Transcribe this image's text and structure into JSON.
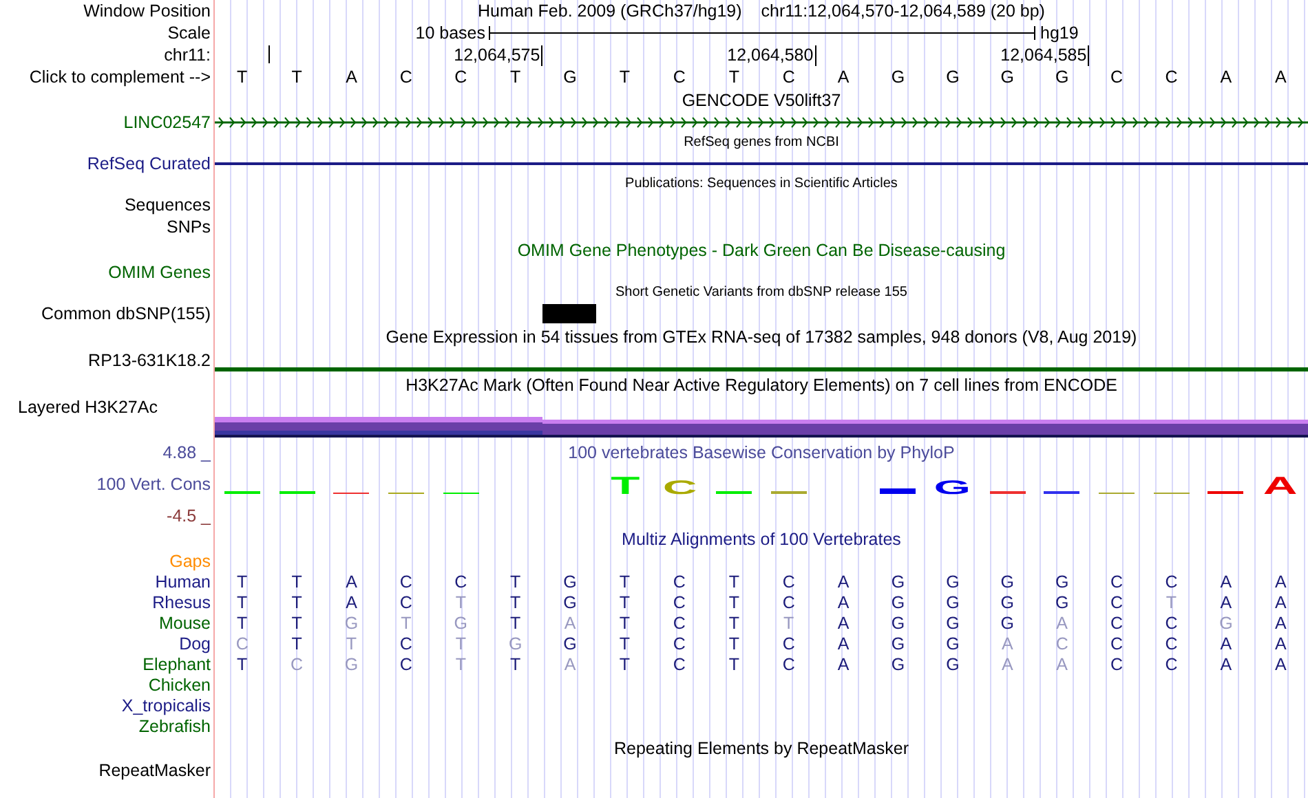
{
  "rows": [
    {
      "kind": "position",
      "label": {
        "text": "Window Position",
        "color": "#000000"
      },
      "assembly": "Human Feb. 2009 (GRCh37/hg19)",
      "position": "chr11:12,064,570-12,064,589 (20 bp)"
    },
    {
      "kind": "scale",
      "label": {
        "text": "Scale",
        "color": "#000000"
      },
      "span": "10 bases",
      "db": "hg19"
    },
    {
      "kind": "ruler",
      "label": {
        "text": "chr11:",
        "color": "#000000"
      },
      "ticks": [
        "12,064,575",
        "12,064,580",
        "12,064,585"
      ]
    },
    {
      "kind": "bases",
      "label": {
        "text": "Click to complement -->",
        "color": "#000000"
      },
      "letters": [
        "T",
        "T",
        "A",
        "C",
        "C",
        "T",
        "G",
        "T",
        "C",
        "T",
        "C",
        "A",
        "G",
        "G",
        "G",
        "G",
        "C",
        "C",
        "A",
        "A"
      ]
    },
    {
      "kind": "title",
      "text": "GENCODE V50lift37",
      "small": false,
      "color": "#000000"
    },
    {
      "kind": "gene",
      "label": {
        "text": "LINC02547",
        "color": "#006400"
      },
      "color": "#006400"
    },
    {
      "kind": "title",
      "text": "RefSeq genes from NCBI",
      "small": true,
      "color": "#000000"
    },
    {
      "kind": "line",
      "label": {
        "text": "RefSeq Curated",
        "color": "#1c1c86"
      },
      "color": "#1c1c86"
    },
    {
      "kind": "title",
      "text": "Publications: Sequences in Scientific Articles",
      "small": true,
      "color": "#000000"
    },
    {
      "kind": "blank",
      "label": {
        "text": "Sequences",
        "color": "#000000"
      }
    },
    {
      "kind": "blank",
      "label": {
        "text": "SNPs",
        "color": "#000000"
      }
    },
    {
      "kind": "title",
      "text": "OMIM Gene Phenotypes - Dark Green Can Be Disease-causing",
      "small": false,
      "color": "#006400"
    },
    {
      "kind": "blank",
      "label": {
        "text": "OMIM Genes",
        "color": "#006400"
      }
    },
    {
      "kind": "title",
      "text": "Short Genetic Variants from dbSNP release 155",
      "small": true,
      "color": "#000000"
    },
    {
      "kind": "snp",
      "label": {
        "text": "Common dbSNP(155)",
        "color": "#000000"
      },
      "covered": [
        false,
        false,
        false,
        false,
        false,
        false,
        true,
        false,
        false,
        false,
        false,
        false,
        false,
        false,
        false,
        false,
        false,
        false,
        false,
        false
      ]
    },
    {
      "kind": "title",
      "text": "Gene Expression in 54 tissues from GTEx RNA-seq of 17382 samples, 948 donors (V8, Aug 2019)",
      "small": false,
      "color": "#000000"
    },
    {
      "kind": "expression",
      "label": {
        "text": "RP13-631K18.2",
        "color": "#000000"
      },
      "color": "#006400"
    },
    {
      "kind": "title",
      "text": "H3K27Ac Mark (Often Found Near Active Regulatory Elements) on 7 cell lines from ENCODE",
      "small": false,
      "color": "#000000"
    },
    {
      "kind": "layered",
      "label": {
        "text": "Layered H3K27Ac",
        "color": "#000000"
      }
    },
    {
      "kind": "title",
      "label": {
        "text": "4.88 _",
        "color": "#4b4b9a"
      },
      "text": "100 vertebrates Basewise Conservation by PhyloP",
      "small": false,
      "color": "#4b4b9a"
    },
    {
      "kind": "logo",
      "label": {
        "text": "100 Vert. Cons",
        "color": "#4b4b9a"
      },
      "logo": [
        {
          "kind": "thin",
          "color": "#00ee00"
        },
        {
          "kind": "thin",
          "color": "#00ee00"
        },
        {
          "kind": "hair",
          "color": "#ee3030"
        },
        {
          "kind": "hair",
          "color": "#aaaa20"
        },
        {
          "kind": "hair",
          "color": "#00ee00"
        },
        {
          "kind": "gap"
        },
        {
          "kind": "gap"
        },
        {
          "kind": "tall",
          "letter": "T",
          "color": "#00ee00"
        },
        {
          "kind": "mid",
          "letter": "C",
          "color": "#aaaa00"
        },
        {
          "kind": "thin",
          "color": "#00ee00"
        },
        {
          "kind": "thin",
          "color": "#aaaa30"
        },
        {
          "kind": "gap"
        },
        {
          "kind": "thick",
          "color": "#0000ee"
        },
        {
          "kind": "mid",
          "letter": "G",
          "color": "#0000ee"
        },
        {
          "kind": "thin",
          "color": "#ee3030"
        },
        {
          "kind": "thin",
          "color": "#3030ee"
        },
        {
          "kind": "hair",
          "color": "#aaaa30"
        },
        {
          "kind": "hair",
          "color": "#aaaa30"
        },
        {
          "kind": "thin",
          "color": "#ee0000"
        },
        {
          "kind": "tall",
          "letter": "A",
          "color": "#ee0000"
        }
      ]
    },
    {
      "kind": "blank",
      "label": {
        "text": "-4.5 _",
        "color": "#8b3a3a"
      }
    },
    {
      "kind": "title",
      "text": "Multiz Alignments of 100 Vertebrates",
      "small": false,
      "color": "#1c1c86"
    },
    {
      "kind": "align",
      "label": {
        "text": "Gaps",
        "color": "#ff8c00"
      }
    },
    {
      "kind": "align",
      "label": {
        "text": "Human",
        "color": "#1c1c86"
      },
      "bases": [
        {
          "letter": "T",
          "match": true
        },
        {
          "letter": "T",
          "match": true
        },
        {
          "letter": "A",
          "match": true
        },
        {
          "letter": "C",
          "match": true
        },
        {
          "letter": "C",
          "match": true
        },
        {
          "letter": "T",
          "match": true
        },
        {
          "letter": "G",
          "match": true
        },
        {
          "letter": "T",
          "match": true
        },
        {
          "letter": "C",
          "match": true
        },
        {
          "letter": "T",
          "match": true
        },
        {
          "letter": "C",
          "match": true
        },
        {
          "letter": "A",
          "match": true
        },
        {
          "letter": "G",
          "match": true
        },
        {
          "letter": "G",
          "match": true
        },
        {
          "letter": "G",
          "match": true
        },
        {
          "letter": "G",
          "match": true
        },
        {
          "letter": "C",
          "match": true
        },
        {
          "letter": "C",
          "match": true
        },
        {
          "letter": "A",
          "match": true
        },
        {
          "letter": "A",
          "match": true
        }
      ]
    },
    {
      "kind": "align",
      "label": {
        "text": "Rhesus",
        "color": "#1c1c86"
      },
      "bases": [
        {
          "letter": "T",
          "match": true
        },
        {
          "letter": "T",
          "match": true
        },
        {
          "letter": "A",
          "match": true
        },
        {
          "letter": "C",
          "match": true
        },
        {
          "letter": "T",
          "match": false
        },
        {
          "letter": "T",
          "match": true
        },
        {
          "letter": "G",
          "match": true
        },
        {
          "letter": "T",
          "match": true
        },
        {
          "letter": "C",
          "match": true
        },
        {
          "letter": "T",
          "match": true
        },
        {
          "letter": "C",
          "match": true
        },
        {
          "letter": "A",
          "match": true
        },
        {
          "letter": "G",
          "match": true
        },
        {
          "letter": "G",
          "match": true
        },
        {
          "letter": "G",
          "match": true
        },
        {
          "letter": "G",
          "match": true
        },
        {
          "letter": "C",
          "match": true
        },
        {
          "letter": "T",
          "match": false
        },
        {
          "letter": "A",
          "match": true
        },
        {
          "letter": "A",
          "match": true
        }
      ]
    },
    {
      "kind": "align",
      "label": {
        "text": "Mouse",
        "color": "#006400"
      },
      "bases": [
        {
          "letter": "T",
          "match": true
        },
        {
          "letter": "T",
          "match": true
        },
        {
          "letter": "G",
          "match": false
        },
        {
          "letter": "T",
          "match": false
        },
        {
          "letter": "G",
          "match": false
        },
        {
          "letter": "T",
          "match": true
        },
        {
          "letter": "A",
          "match": false
        },
        {
          "letter": "T",
          "match": true
        },
        {
          "letter": "C",
          "match": true
        },
        {
          "letter": "T",
          "match": true
        },
        {
          "letter": "T",
          "match": false
        },
        {
          "letter": "A",
          "match": true
        },
        {
          "letter": "G",
          "match": true
        },
        {
          "letter": "G",
          "match": true
        },
        {
          "letter": "G",
          "match": true
        },
        {
          "letter": "A",
          "match": false
        },
        {
          "letter": "C",
          "match": true
        },
        {
          "letter": "C",
          "match": true
        },
        {
          "letter": "G",
          "match": false
        },
        {
          "letter": "A",
          "match": true
        }
      ]
    },
    {
      "kind": "align",
      "label": {
        "text": "Dog",
        "color": "#1c1c86"
      },
      "bases": [
        {
          "letter": "C",
          "match": false
        },
        {
          "letter": "T",
          "match": true
        },
        {
          "letter": "T",
          "match": false
        },
        {
          "letter": "C",
          "match": true
        },
        {
          "letter": "T",
          "match": false
        },
        {
          "letter": "G",
          "match": false
        },
        {
          "letter": "G",
          "match": true
        },
        {
          "letter": "T",
          "match": true
        },
        {
          "letter": "C",
          "match": true
        },
        {
          "letter": "T",
          "match": true
        },
        {
          "letter": "C",
          "match": true
        },
        {
          "letter": "A",
          "match": true
        },
        {
          "letter": "G",
          "match": true
        },
        {
          "letter": "G",
          "match": true
        },
        {
          "letter": "A",
          "match": false
        },
        {
          "letter": "C",
          "match": false
        },
        {
          "letter": "C",
          "match": true
        },
        {
          "letter": "C",
          "match": true
        },
        {
          "letter": "A",
          "match": true
        },
        {
          "letter": "A",
          "match": true
        }
      ]
    },
    {
      "kind": "align",
      "label": {
        "text": "Elephant",
        "color": "#006400"
      },
      "bases": [
        {
          "letter": "T",
          "match": true
        },
        {
          "letter": "C",
          "match": false
        },
        {
          "letter": "G",
          "match": false
        },
        {
          "letter": "C",
          "match": true
        },
        {
          "letter": "T",
          "match": false
        },
        {
          "letter": "T",
          "match": true
        },
        {
          "letter": "A",
          "match": false
        },
        {
          "letter": "T",
          "match": true
        },
        {
          "letter": "C",
          "match": true
        },
        {
          "letter": "T",
          "match": true
        },
        {
          "letter": "C",
          "match": true
        },
        {
          "letter": "A",
          "match": true
        },
        {
          "letter": "G",
          "match": true
        },
        {
          "letter": "G",
          "match": true
        },
        {
          "letter": "A",
          "match": false
        },
        {
          "letter": "A",
          "match": false
        },
        {
          "letter": "C",
          "match": true
        },
        {
          "letter": "C",
          "match": true
        },
        {
          "letter": "A",
          "match": true
        },
        {
          "letter": "A",
          "match": true
        }
      ]
    },
    {
      "kind": "align",
      "label": {
        "text": "Chicken",
        "color": "#006400"
      }
    },
    {
      "kind": "align",
      "label": {
        "text": "X_tropicalis",
        "color": "#1c1c86"
      }
    },
    {
      "kind": "align",
      "label": {
        "text": "Zebrafish",
        "color": "#006400"
      }
    },
    {
      "kind": "title",
      "text": "Repeating Elements by RepeatMasker",
      "small": false,
      "color": "#000000"
    },
    {
      "kind": "blank",
      "label": {
        "text": "RepeatMasker",
        "color": "#000000"
      }
    }
  ]
}
